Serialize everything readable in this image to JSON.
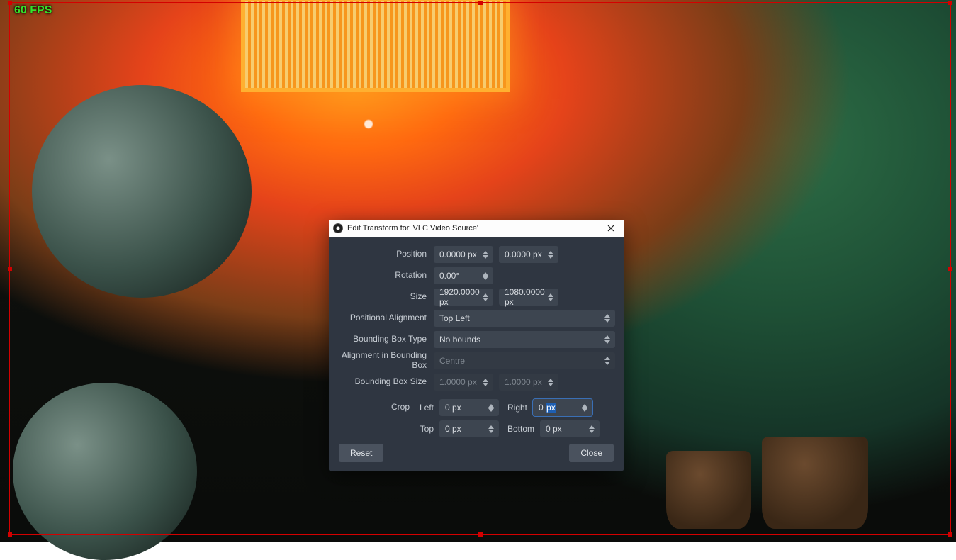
{
  "overlay": {
    "fps": "60 FPS"
  },
  "dialog": {
    "title": "Edit Transform for 'VLC Video Source'",
    "labels": {
      "position": "Position",
      "rotation": "Rotation",
      "size": "Size",
      "positional_alignment": "Positional Alignment",
      "bounding_box_type": "Bounding Box Type",
      "alignment_in_bb": "Alignment in Bounding Box",
      "bounding_box_size": "Bounding Box Size",
      "crop": "Crop",
      "crop_left": "Left",
      "crop_right": "Right",
      "crop_top": "Top",
      "crop_bottom": "Bottom"
    },
    "values": {
      "position_x": "0.0000 px",
      "position_y": "0.0000 px",
      "rotation": "0.00°",
      "size_w": "1920.0000 px",
      "size_h": "1080.0000 px",
      "positional_alignment": "Top Left",
      "bounding_box_type": "No bounds",
      "alignment_in_bb": "Centre",
      "bounding_box_w": "1.0000 px",
      "bounding_box_h": "1.0000 px",
      "crop_left": "0 px",
      "crop_right": "0 px",
      "crop_top": "0 px",
      "crop_bottom": "0 px"
    },
    "buttons": {
      "reset": "Reset",
      "close": "Close"
    }
  }
}
